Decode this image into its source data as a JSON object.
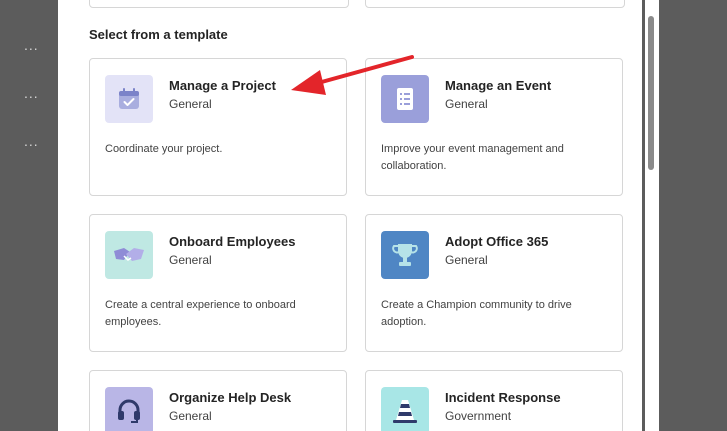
{
  "background": {
    "dots": [
      "...",
      "...",
      "..."
    ]
  },
  "dialog": {
    "section_title": "Select from a template",
    "templates": [
      {
        "title": "Manage a Project",
        "category": "General",
        "description": "Coordinate your project.",
        "icon": "calendar-check-icon",
        "tile_color": "#e3e3f7",
        "icon_color": "#7b83c9"
      },
      {
        "title": "Manage an Event",
        "category": "General",
        "description": "Improve your event management and collaboration.",
        "icon": "checklist-icon",
        "tile_color": "#9a9fda",
        "icon_color": "#ffffff"
      },
      {
        "title": "Onboard Employees",
        "category": "General",
        "description": "Create a central experience to onboard employees.",
        "icon": "handshake-icon",
        "tile_color": "#bfe8e3",
        "icon_color": "#8f8cd6"
      },
      {
        "title": "Adopt Office 365",
        "category": "General",
        "description": "Create a Champion community to drive adoption.",
        "icon": "trophy-icon",
        "tile_color": "#4f86c4",
        "icon_color": "#b6e3e8"
      },
      {
        "title": "Organize Help Desk",
        "category": "General",
        "description": "",
        "icon": "headset-icon",
        "tile_color": "#b9b6e6",
        "icon_color": "#2f3a6b"
      },
      {
        "title": "Incident Response",
        "category": "Government",
        "description": "",
        "icon": "traffic-cone-icon",
        "tile_color": "#a8e6e6",
        "icon_color": "#2f3a6b"
      }
    ]
  },
  "annotation": {
    "arrow_color": "#e3252a"
  },
  "colors": {
    "scrollbar": "#8a8a8a",
    "overlay": "#5c5c5c"
  }
}
